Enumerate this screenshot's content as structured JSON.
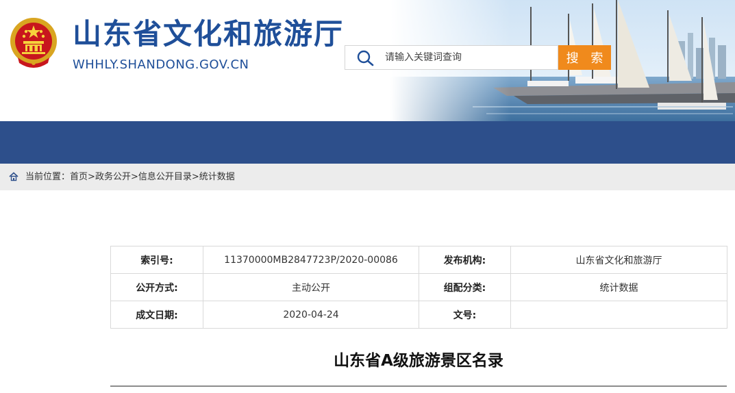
{
  "header": {
    "site_title": "山东省文化和旅游厅",
    "site_domain": "WHHLY.SHANDONG.GOV.CN",
    "search_placeholder": "请输入关键词查询",
    "search_button": "搜 索"
  },
  "colors": {
    "brand_blue": "#1f4f99",
    "nav_blue": "#2d4f8b",
    "search_orange": "#f08a1c",
    "breadcrumb_bg": "#ececec"
  },
  "breadcrumb": {
    "prefix": "当前位置：",
    "items": [
      "首页",
      "政务公开",
      "信息公开目录",
      "统计数据"
    ],
    "separator": ">"
  },
  "meta": {
    "rows": [
      {
        "label1": "索引号:",
        "value1": "11370000MB2847723P/2020-00086",
        "label2": "发布机构:",
        "value2": "山东省文化和旅游厅"
      },
      {
        "label1": "公开方式:",
        "value1": "主动公开",
        "label2": "组配分类:",
        "value2": "统计数据"
      },
      {
        "label1": "成文日期:",
        "value1": "2020-04-24",
        "label2": "文号:",
        "value2": ""
      }
    ]
  },
  "article": {
    "title": "山东省A级旅游景区名录"
  },
  "icons": {
    "emblem": "national-emblem-icon",
    "search": "search-icon",
    "home": "home-icon"
  }
}
